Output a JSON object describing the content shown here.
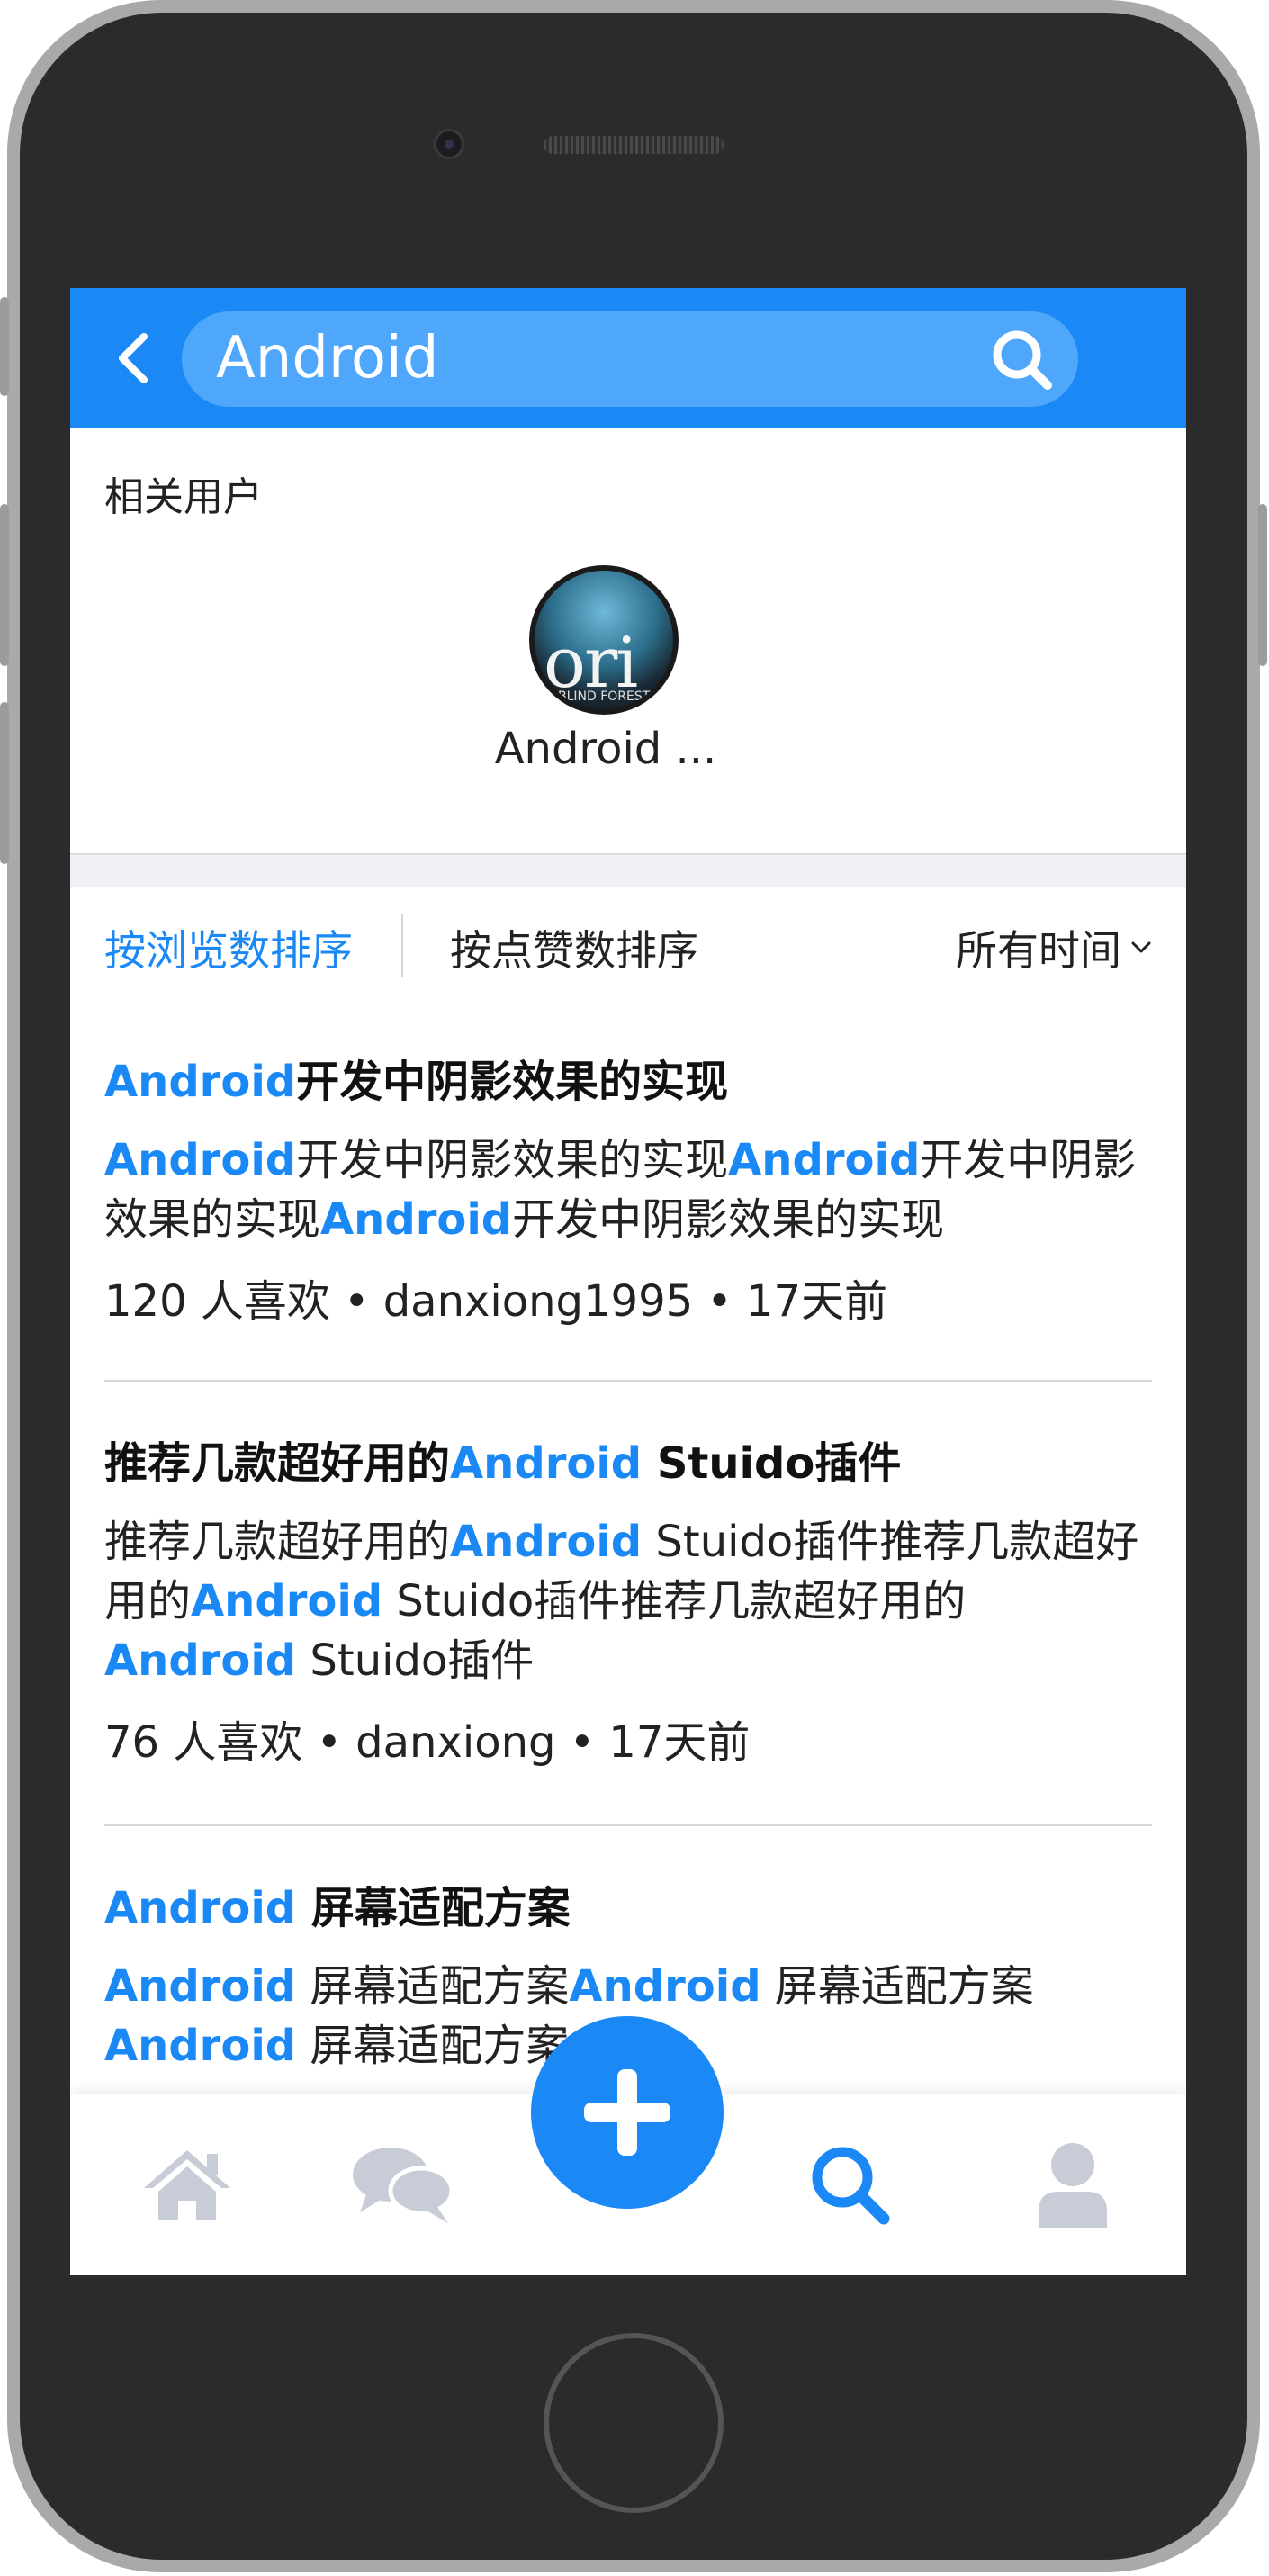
{
  "search": {
    "query": "Android"
  },
  "related_users": {
    "label": "相关用户",
    "users": [
      {
        "name": "Android ...",
        "avatar_text": "ori",
        "avatar_subtext": "BLIND FOREST"
      }
    ]
  },
  "sort": {
    "by_views": "按浏览数排序",
    "by_likes": "按点赞数排序",
    "time_filter": "所有时间",
    "active": "by_views"
  },
  "posts": [
    {
      "title": [
        {
          "t": "Android",
          "hl": true
        },
        {
          "t": "开发中阴影效果的实现",
          "hl": false
        }
      ],
      "body": [
        {
          "t": "Android",
          "hl": true
        },
        {
          "t": "开发中阴影效果的实现",
          "hl": false
        },
        {
          "t": "Android",
          "hl": true
        },
        {
          "t": "开发中阴影效果的实现",
          "hl": false
        },
        {
          "t": "Android",
          "hl": true
        },
        {
          "t": "开发中阴影效果的实现",
          "hl": false
        }
      ],
      "meta": "120 人喜欢 • danxiong1995 • 17天前"
    },
    {
      "title": [
        {
          "t": "推荐几款超好用的",
          "hl": false
        },
        {
          "t": "Android",
          "hl": true
        },
        {
          "t": " Stuido插件",
          "hl": false
        }
      ],
      "body": [
        {
          "t": "推荐几款超好用的",
          "hl": false
        },
        {
          "t": "Android",
          "hl": true
        },
        {
          "t": " Stuido插件推荐几款超好用的",
          "hl": false
        },
        {
          "t": "Android",
          "hl": true
        },
        {
          "t": " Stuido插件推荐几款超好用的",
          "hl": false
        },
        {
          "t": "Android",
          "hl": true
        },
        {
          "t": " Stuido插件",
          "hl": false
        }
      ],
      "meta": "76 人喜欢 • danxiong • 17天前"
    },
    {
      "title": [
        {
          "t": "Android",
          "hl": true
        },
        {
          "t": " 屏幕适配方案",
          "hl": false
        }
      ],
      "body": [
        {
          "t": "Android",
          "hl": true
        },
        {
          "t": " 屏幕适配方案",
          "hl": false
        },
        {
          "t": "Android",
          "hl": true
        },
        {
          "t": " 屏幕适配方案",
          "hl": false
        },
        {
          "t": "Android",
          "hl": true
        },
        {
          "t": " 屏幕适配方案",
          "hl": false
        }
      ],
      "meta": ""
    }
  ],
  "tabbar": {
    "tabs": [
      {
        "name": "home",
        "icon": "home-icon",
        "active": false
      },
      {
        "name": "messages",
        "icon": "chat-icon",
        "active": false
      },
      {
        "name": "search",
        "icon": "search-icon",
        "active": true
      },
      {
        "name": "profile",
        "icon": "user-icon",
        "active": false
      }
    ],
    "fab_icon": "plus-icon"
  },
  "colors": {
    "accent": "#1a88f5",
    "inactive_icon": "#c8ccd6",
    "search_bg": "#4ea7fb"
  }
}
